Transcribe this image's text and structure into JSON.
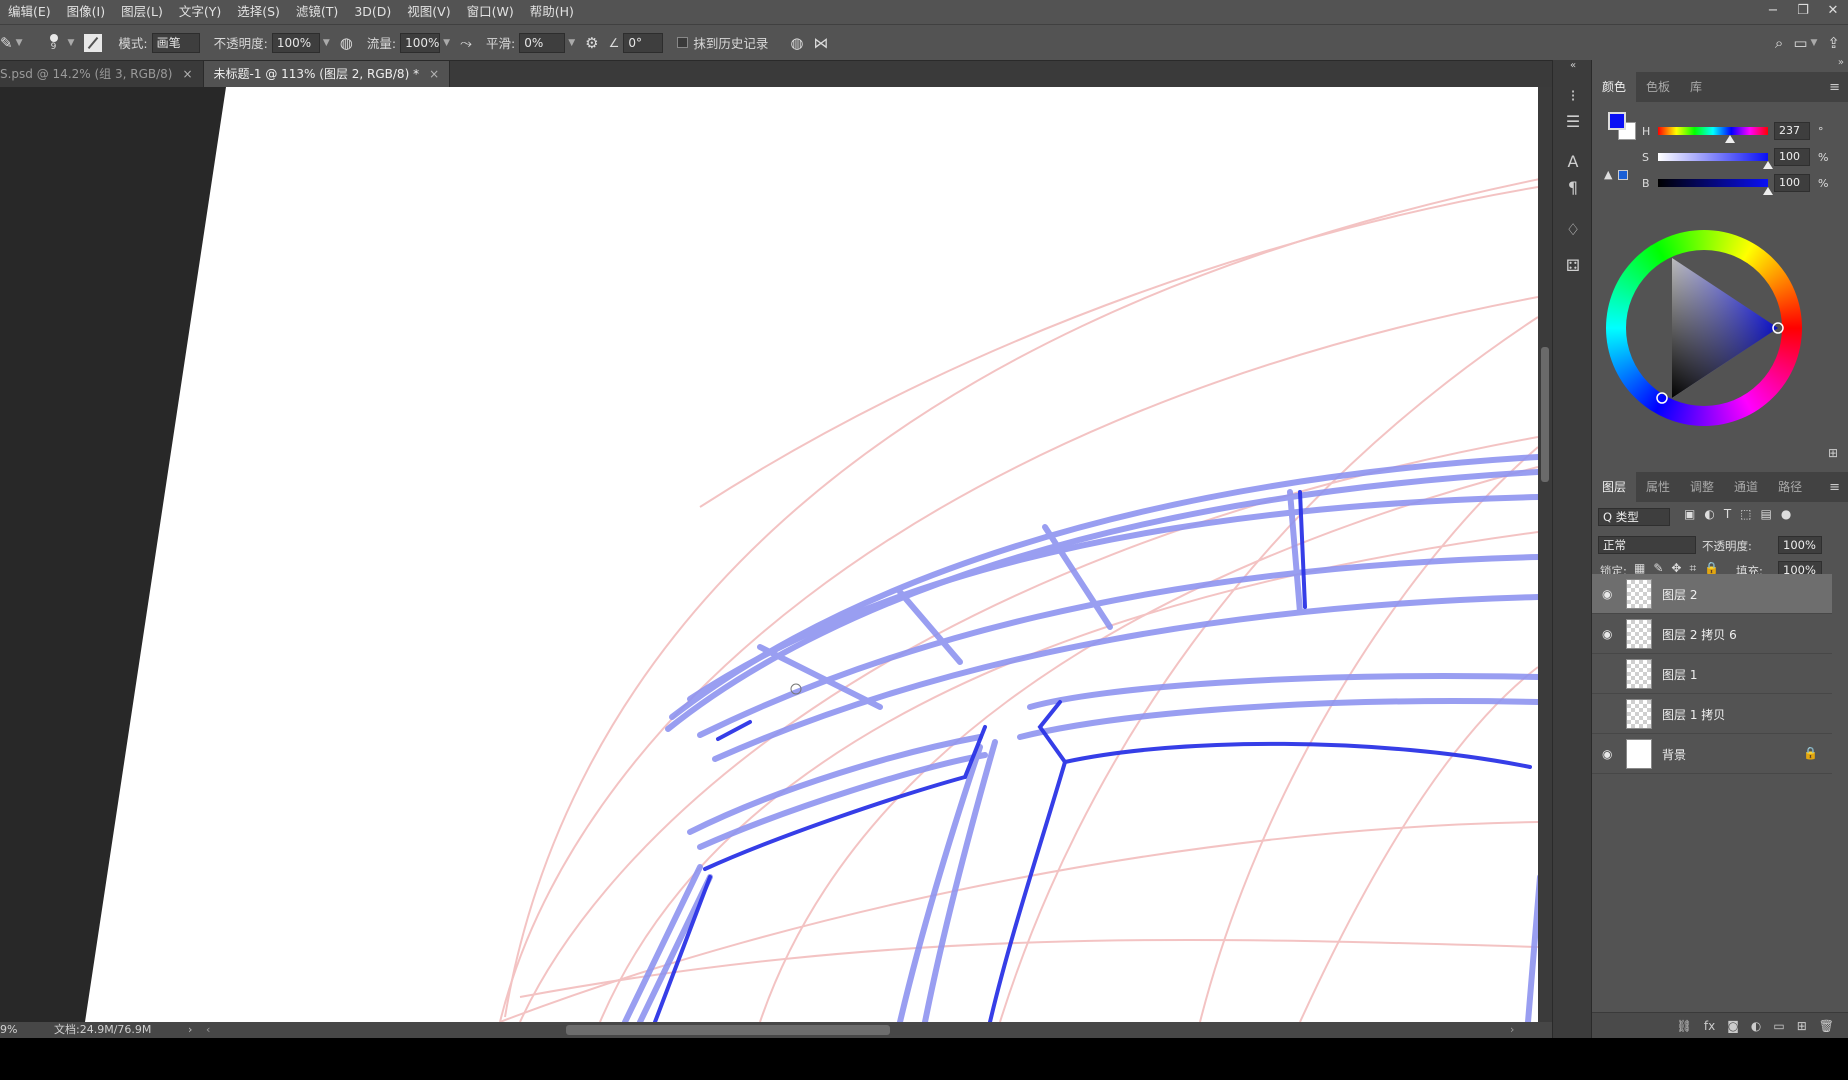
{
  "menubar": {
    "items": [
      "编辑(E)",
      "图像(I)",
      "图层(L)",
      "文字(Y)",
      "选择(S)",
      "滤镜(T)",
      "3D(D)",
      "视图(V)",
      "窗口(W)",
      "帮助(H)"
    ],
    "window_controls": [
      "−",
      "❐",
      "✕"
    ]
  },
  "options": {
    "brush_size": "9",
    "mode_label": "模式:",
    "mode_value": "画笔",
    "opacity_label": "不透明度:",
    "opacity_value": "100%",
    "flow_label": "流量:",
    "flow_value": "100%",
    "smooth_label": "平滑:",
    "smooth_value": "0%",
    "angle_value": "0°",
    "history_label": "抹到历史记录"
  },
  "tabs": [
    {
      "label": "S.psd @ 14.2% (组 3, RGB/8)",
      "active": false
    },
    {
      "label": "未标题-1 @ 113% (图层 2, RGB/8) *",
      "active": true
    }
  ],
  "status": {
    "zoom": "9%",
    "doc": "文档:24.9M/76.9M"
  },
  "color_panel": {
    "tabs": [
      "颜色",
      "色板",
      "库"
    ],
    "foreground": "#0a10f5",
    "background": "#ffffff",
    "h_label": "H",
    "h_value": "237",
    "h_unit": "°",
    "h_level": 0.658,
    "s_label": "S",
    "s_value": "100",
    "s_unit": "%",
    "s_level": 1.0,
    "b_label": "B",
    "b_value": "100",
    "b_unit": "%",
    "b_level": 1.0
  },
  "layers_panel": {
    "tabs": [
      "图层",
      "属性",
      "调整",
      "通道",
      "路径"
    ],
    "filter_label": "Q 类型",
    "blend_mode": "正常",
    "opacity_label": "不透明度:",
    "opacity_value": "100%",
    "lock_label": "锁定:",
    "fill_label": "填充:",
    "fill_value": "100%",
    "layers": [
      {
        "name": "图层 2",
        "visible": true,
        "selected": true,
        "thumb": "transparent"
      },
      {
        "name": "图层 2 拷贝 6",
        "visible": true,
        "selected": false,
        "thumb": "transparent"
      },
      {
        "name": "图层 1",
        "visible": false,
        "selected": false,
        "thumb": "transparent"
      },
      {
        "name": "图层 1 拷贝",
        "visible": false,
        "selected": false,
        "thumb": "transparent"
      },
      {
        "name": "背景",
        "visible": true,
        "selected": false,
        "thumb": "white",
        "locked": true
      }
    ]
  },
  "colors": {
    "guide": "#f2b9b9",
    "stroke": "#2b34e6",
    "stroke_light": "#8e94f0"
  }
}
